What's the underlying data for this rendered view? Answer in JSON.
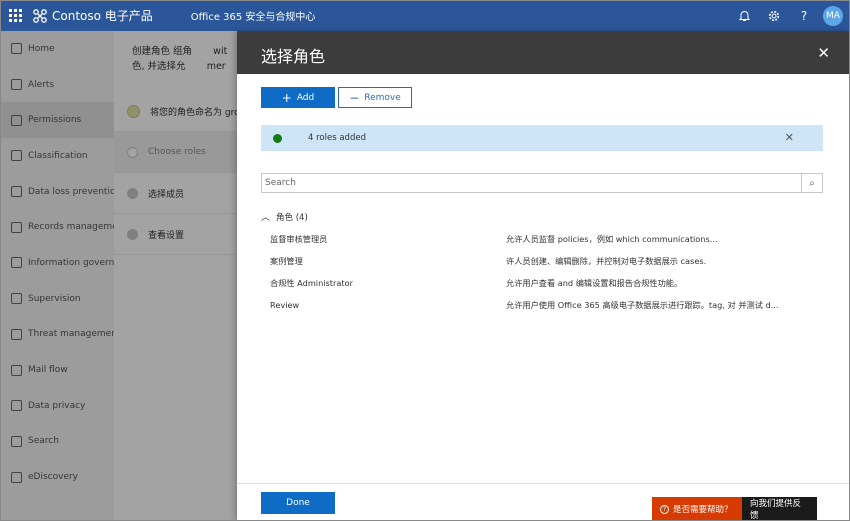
{
  "topbar": {
    "brand": "Contoso 电子产品",
    "app_title": "Office 365 安全与合规中心",
    "avatar_initials": "MA",
    "icons": [
      "waffle-icon",
      "bell-icon",
      "gear-icon",
      "help-icon"
    ]
  },
  "leftnav": {
    "items": [
      {
        "label": "Home",
        "icon": "home-icon"
      },
      {
        "label": "Alerts",
        "icon": "alert-icon"
      },
      {
        "label": "Permissions",
        "icon": "permissions-icon"
      },
      {
        "label": "Classification",
        "icon": "classification-icon"
      },
      {
        "label": "Data loss prevention",
        "icon": "dlp-icon"
      },
      {
        "label": "Records managemer",
        "icon": "records-icon"
      },
      {
        "label": "Information governa",
        "icon": "lock-icon"
      },
      {
        "label": "Supervision",
        "icon": "eye-icon"
      },
      {
        "label": "Threat management",
        "icon": "biohazard-icon"
      },
      {
        "label": "Mail flow",
        "icon": "mail-icon"
      },
      {
        "label": "Data privacy",
        "icon": "lock-icon"
      },
      {
        "label": "Search",
        "icon": "search-icon"
      },
      {
        "label": "eDiscovery",
        "icon": "ediscovery-icon"
      }
    ]
  },
  "wizard": {
    "heading_line1": "创建角色 组角",
    "heading_line2": "色, 并选择允",
    "heading_extra1": "wit",
    "heading_extra2": "mer",
    "steps": [
      {
        "label": "将您的角色命名为 grot",
        "state": "done"
      },
      {
        "label": "Choose roles",
        "state": "current"
      },
      {
        "label": "选择成员",
        "state": "pending"
      },
      {
        "label": "查看设置",
        "state": "pending"
      }
    ]
  },
  "panel": {
    "title": "选择角色",
    "add_label": "Add",
    "remove_label": "Remove",
    "message": "4 roles added",
    "search_placeholder": "Search",
    "group_label": "角色 (4)",
    "roles": [
      {
        "name": "监督审核管理员",
        "description": "允许人员监督 policies，例如 which communications..."
      },
      {
        "name": "案例管理",
        "description": "许人员创建、编辑删除，并控制对电子数据展示 cases."
      },
      {
        "name": "合规性 Administrator",
        "description": "允许用户查看 and 编辑设置和报告合规性功能。"
      },
      {
        "name": "Review",
        "description": "允许用户使用 Office 365 高级电子数据展示进行跟踪。tag, 对 并测试 d..."
      }
    ],
    "done_label": "Done"
  },
  "help": {
    "need_help": "是否需要帮助？",
    "feedback": "向我们提供反馈"
  }
}
